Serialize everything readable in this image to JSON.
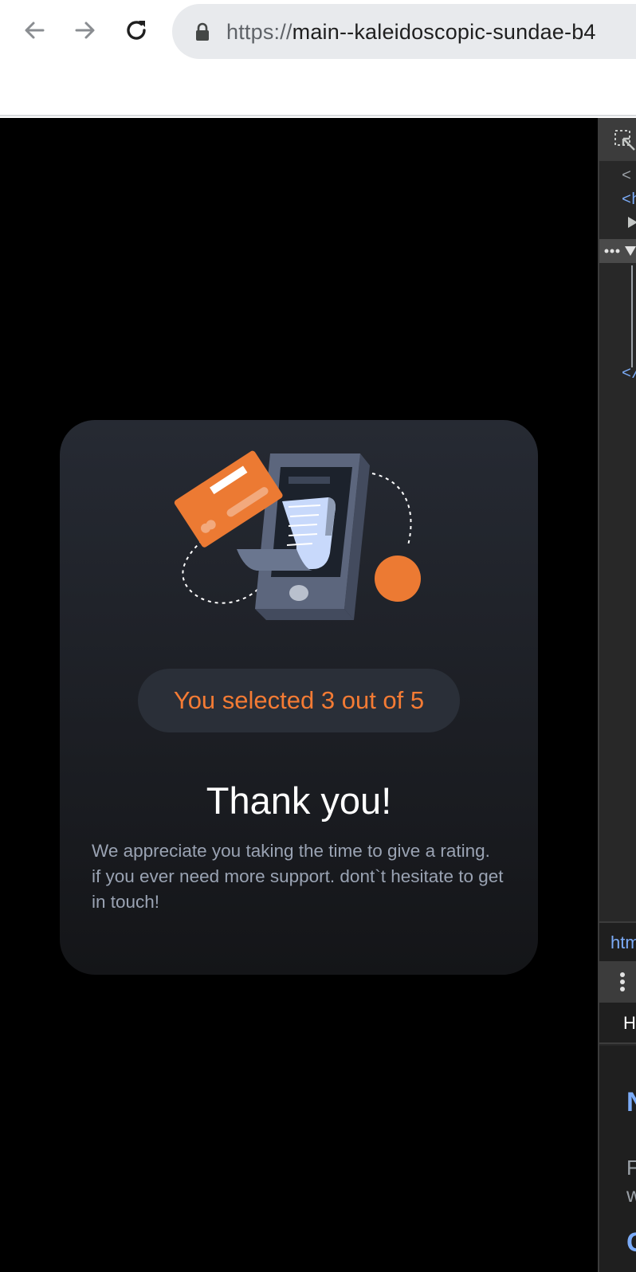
{
  "browser": {
    "url_scheme": "https://",
    "url_host": "main--kaleidoscopic-sundae-b4"
  },
  "card": {
    "selection_text": "You selected 3 out of 5",
    "rating": {
      "selected": 3,
      "max": 5
    },
    "title": "Thank you!",
    "description_line1": "We appreciate you taking the time to give a rating.",
    "description_line2": "if you ever need more support. dont`t hesitate to get in touch!"
  },
  "devtools": {
    "line1": "<",
    "line2": "<h",
    "line3": "</",
    "breadcrumb": "htm",
    "tab": "H",
    "heading": "N",
    "body1": "F",
    "body2": "w",
    "link": "C"
  },
  "colors": {
    "accent": "#f47b34",
    "card_top": "#262a33",
    "card_bottom": "#141518",
    "text_muted": "#9aa3b3",
    "pill_bg": "#2a2f38"
  },
  "icons": {
    "back": "arrow-left-icon",
    "forward": "arrow-right-icon",
    "reload": "reload-icon",
    "lock": "lock-icon",
    "inspect": "inspect-element-icon"
  }
}
